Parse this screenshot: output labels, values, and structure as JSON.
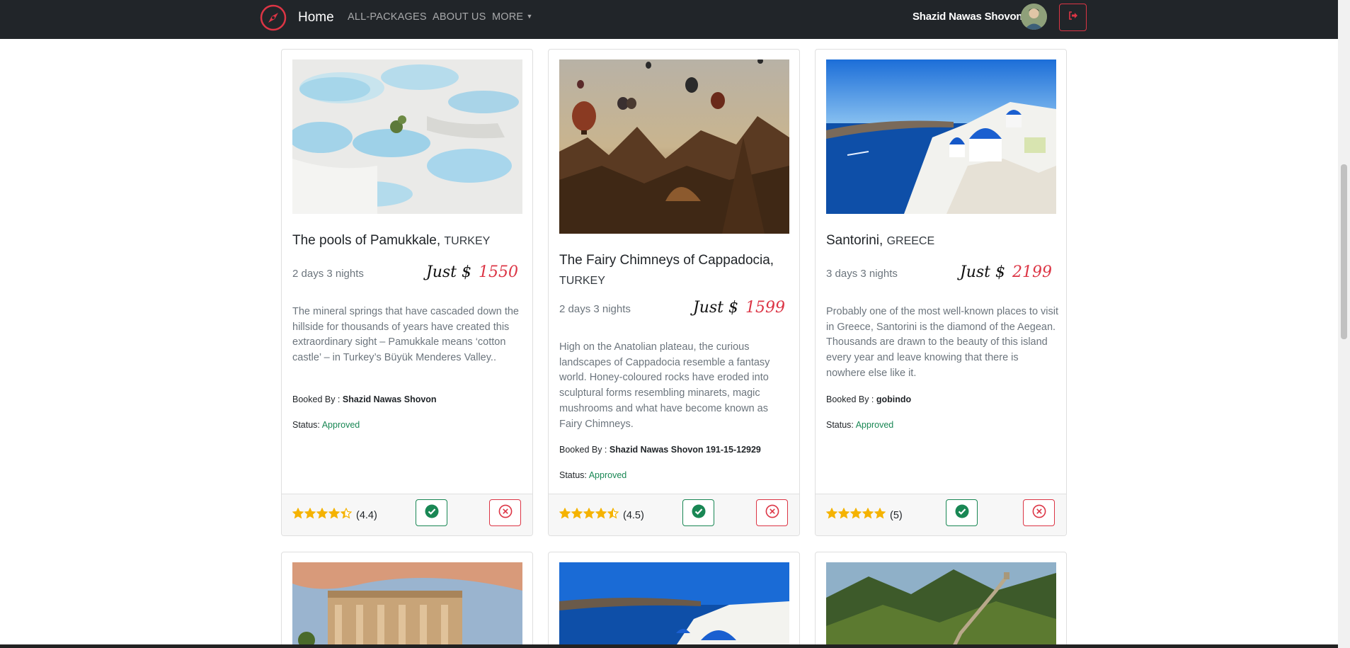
{
  "nav": {
    "home": "Home",
    "links": [
      "ALL-PACKAGES",
      "ABOUT US",
      "MORE"
    ],
    "user_name": "Shazid Nawas Shovon"
  },
  "labels": {
    "price_prefix": "Just $",
    "booked_by": "Booked By :",
    "status": "Status:"
  },
  "cards": [
    {
      "title": "The pools of Pamukkale,",
      "country": "TURKEY",
      "duration": "2 days 3 nights",
      "price": "1550",
      "description": "The mineral springs that have cascaded down the hillside for thousands of years have created this extraordinary sight – Pamukkale means ‘cotton castle’ – in Turkey’s Büyük Menderes Valley..",
      "booked_by": "Shazid Nawas Shovon",
      "status": "Approved",
      "rating": "(4.4)",
      "stars": 4.4
    },
    {
      "title": "The Fairy Chimneys of Cappadocia,",
      "country": "TURKEY",
      "duration": "2 days 3 nights",
      "price": "1599",
      "description": "High on the Anatolian plateau, the curious landscapes of Cappadocia resemble a fantasy world. Honey-coloured rocks have eroded into sculptural forms resembling minarets, magic mushrooms and what have become known as Fairy Chimneys.",
      "booked_by": "Shazid Nawas Shovon 191-15-12929",
      "status": "Approved",
      "rating": "(4.5)",
      "stars": 4.5
    },
    {
      "title": "Santorini,",
      "country": "GREECE",
      "duration": "3 days 3 nights",
      "price": "2199",
      "description": "Probably one of the most well-known places to visit in Greece, Santorini is the diamond of the Aegean. Thousands are drawn to the beauty of this island every year and leave knowing that there is nowhere else like it.",
      "booked_by": "gobindo",
      "status": "Approved",
      "rating": "(5)",
      "stars": 5
    }
  ],
  "colors": {
    "accent_red": "#dc3545",
    "success_green": "#198754",
    "navbar": "#212529"
  }
}
